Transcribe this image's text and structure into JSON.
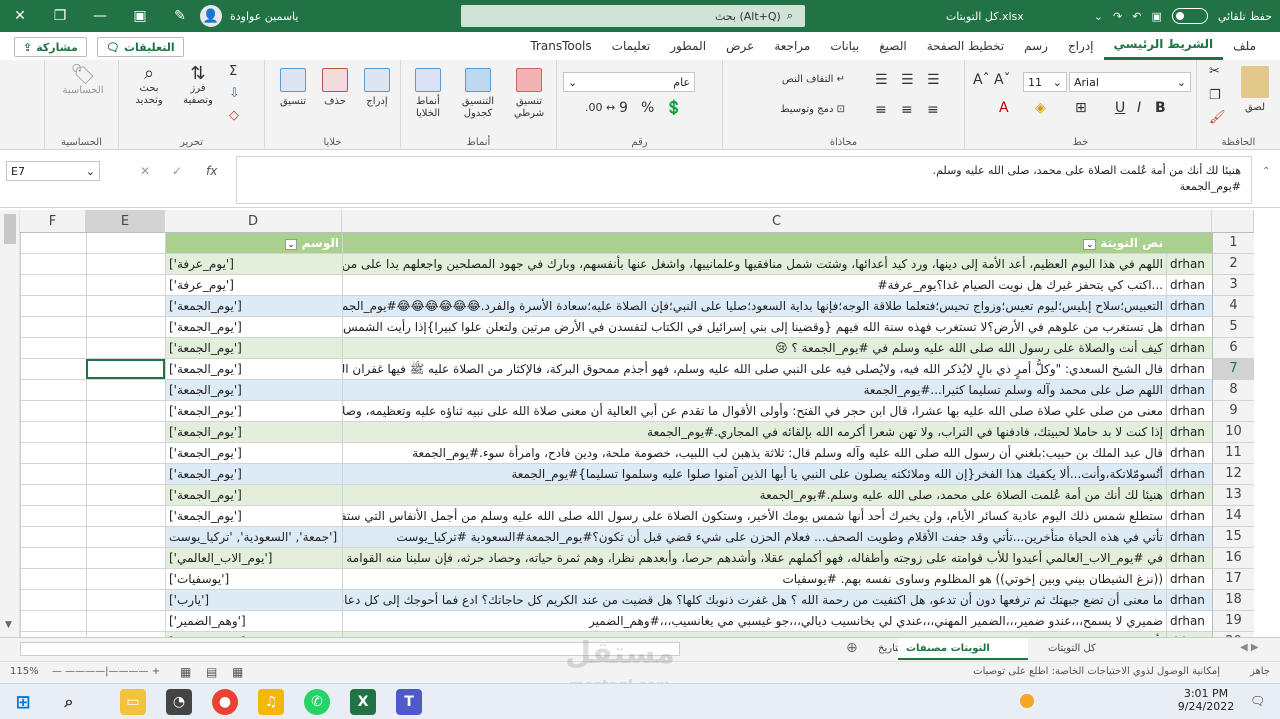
{
  "titlebar": {
    "autosave": "حفظ تلقائي",
    "filename": "كل التوبتات.xlsx",
    "search": "بحث (Alt+Q)",
    "user": "ياسمين عواودة"
  },
  "menu": {
    "tabs": [
      "ملف",
      "الشريط الرئيسي",
      "إدراج",
      "رسم",
      "تخطيط الصفحة",
      "الصيغ",
      "بيانات",
      "مراجعة",
      "عرض",
      "المطور",
      "تعليمات",
      "TransTools"
    ],
    "active": "الشريط الرئيسي",
    "share": "مشاركة",
    "comments": "التعليقات"
  },
  "ribbon": {
    "clipboard": {
      "label": "الحافظة",
      "paste": "لصق"
    },
    "font": {
      "label": "خط",
      "name": "Arial",
      "size": "11"
    },
    "alignment": {
      "label": "محاذاة",
      "wrap": "التفاف النص",
      "merge": "دمج وتوسيط"
    },
    "number": {
      "label": "رقم",
      "format": "عام"
    },
    "styles": {
      "label": "أنماط",
      "cond": "تنسيق شرطي",
      "table": "التنسيق كجدول",
      "cell": "أنماط الخلايا"
    },
    "cells": {
      "label": "خلايا",
      "insert": "إدراج",
      "delete": "حذف",
      "format": "تنسيق"
    },
    "editing": {
      "label": "تحرير",
      "sort": "فرز وتصفية",
      "find": "بحث وتحديد"
    },
    "analysis": {
      "label": "الحساسية",
      "button": "الحساسية"
    }
  },
  "formula": {
    "namebox": "E7",
    "line1": "هنيئا لك أنك من أمة عُلمت الصلاة على محمد، صلى الله عليه وسلم.",
    "line2": "#يوم_الجمعة"
  },
  "columns": [
    "F",
    "E",
    "D",
    "C"
  ],
  "header": {
    "b": "",
    "c": "نص التويتة",
    "d": "الوسم"
  },
  "rows": [
    {
      "n": "2",
      "b": "drhan",
      "c": "اللهم في هذا اليوم العظيم، أعد الأمة إلى دينها، ورد كيد أعدائها، وشتت شمل منافقيها وعلمانييها، واشغل عنها بأنفسهم، وبارك في جهود المصلحين واجعلهم يدا على من",
      "d": "['يوم_عرفة']",
      "s": "g"
    },
    {
      "n": "3",
      "b": "drhan",
      "c": "...اكتب كي يتحفز غيرك هل نويت الصيام غدا؟يوم_عرفة#",
      "d": "['يوم_عرفة']",
      "s": ""
    },
    {
      "n": "4",
      "b": "drhan",
      "c": "التعبيس؛سلاح إبليس؛ليوم تعيس؛وزواج تحيس؛فتعلما طلاقة الوجه؛فإنها بداية السعود؛صليا على النبي؛فإن الصلاة عليه؛سعادة الأسرة والفرد.😂😂😂😂😂😂#يوم_الجمعة",
      "d": "['يوم_الجمعة']",
      "s": "b"
    },
    {
      "n": "5",
      "b": "drhan",
      "c": "هل تستغرب من علوهم في الأرض؟لا تستغرب فهذه سنة الله فيهم {وقضينا إلى بني إسرائيل في الكتاب لتفسدن في الأرض مرتين ولتعلن علوا كبيرا}إذا رأيت الشمس في",
      "d": "['يوم_الجمعة']",
      "s": ""
    },
    {
      "n": "6",
      "b": "drhan",
      "c": "كيف أنت والصلاة على رسول الله صلى الله عليه وسلم في #يوم_الجمعة ؟ 😢",
      "d": "['يوم_الجمعة']",
      "s": "g"
    },
    {
      "n": "7",
      "b": "drhan",
      "c": "قال الشيخ السعدي: \"وكلُّ أمرٍ ذي بالٍ لايُذكر الله فيه، ولايُصلى فيه على النبي صلى الله عليه وسلم، فهو أجذم ممحوق البركة، فالإكثار من الصلاة عليه ﷺ فيها غفران الزلا",
      "d": "['يوم_الجمعة']",
      "s": ""
    },
    {
      "n": "8",
      "b": "drhan",
      "c": "اللهم صل على محمد وآله وسلم تسليما كثيرا...#يوم_الجمعة",
      "d": "['يوم_الجمعة']",
      "s": "b"
    },
    {
      "n": "9",
      "b": "drhan",
      "c": "معنى من صلى علي صلاة صلى الله عليه بها عشرا، قال ابن حجر في الفتح: وأولى الأقوال ما تقدم عن أبي العالية أن معنى صلاة الله على نبيه ثناؤه عليه وتعظيمه، وصلا",
      "d": "['يوم_الجمعة']",
      "s": ""
    },
    {
      "n": "10",
      "b": "drhan",
      "c": "إذا كنت لا بد حاملا لحبيتك، فادفنها في التراب، ولا تهن شعرا أكرمه الله بإلقائه في المجاري.#يوم_الجمعة",
      "d": "['يوم_الجمعة']",
      "s": "g"
    },
    {
      "n": "11",
      "b": "drhan",
      "c": "قال عبد الملك بن حبيب:بلغني أن رسول الله صلى الله عليه وآله وسلم قال: ثلاثة يذهبن لب اللبيب، خصومة ملحة، ودين فادح، وامرأة سوء.#يوم_الجمعة",
      "d": "['يوم_الجمعة']",
      "s": ""
    },
    {
      "n": "12",
      "b": "drhan",
      "c": "أتُسومّلاتكة،وأنت...ألا يكفيك هذا الفخر{إن الله وملائكته يصلون على النبي يا أيها الذين آمنوا صلوا عليه وسلموا تسليما}#يوم_الجمعة",
      "d": "['يوم_الجمعة']",
      "s": "b"
    },
    {
      "n": "13",
      "b": "drhan",
      "c": "هنيئا لك أنك من أمة عُلمت الصلاة على محمد، صلى الله عليه وسلم.#يوم_الجمعة",
      "d": "['يوم_الجمعة']",
      "s": "g"
    },
    {
      "n": "14",
      "b": "drhan",
      "c": "ستطلع شمس ذلك اليوم عادية كسائر الأيام، ولن يخبرك أحد أنها شمس يومك الأخير، وستكون الصلاة على رسول الله صلى الله عليه وسلم من أجمل الأنفاس التي ستفرح بها",
      "d": "['يوم_الجمعة']",
      "s": ""
    },
    {
      "n": "15",
      "b": "drhan",
      "c": "تأتي في هذه الحياة متأخرين...تأتي وقد جفت الأقلام وطويت الصحف... فعلام الحزن على شيء قضي قبل أن تكون؟#يوم_الجمعة#السعودية #تركيا_يوست",
      "d": "جمعة', 'السعودية', 'تركيا_يوست']",
      "s": "b"
    },
    {
      "n": "16",
      "b": "drhan",
      "c": "في #يوم_الاب_العالمي أعيدوا للأب قوامته على زوجته وأطفاله، فهو أكملهم عقلا، وأشدهم حرصا، وأبعدهم نظرا، وهم ثمرة حياته، وحصاد حرثه، فإن سلبنا منه القوامة",
      "d": "['يوم_الاب_العالمي']",
      "s": "g"
    },
    {
      "n": "17",
      "b": "drhan",
      "c": "((نزغ الشيطان بيني وبين إخوتي)) هو المظلوم وساوى نفسه بهم. #يوسفيات",
      "d": "['يوسفيات']",
      "s": ""
    },
    {
      "n": "18",
      "b": "drhan",
      "c": "ما معنى أن تضع جبهتك ثم ترفعها دون أن تدعو، هل اكتفيت من رحمة الله ؟ هل غفرت ذنوبك كلها؟ هل قضيت من عند الكريم كل حاجاتك؟ ادع فما أحوجك إلى كل دعاء",
      "d": "['يارب']",
      "s": "b"
    },
    {
      "n": "19",
      "b": "drhan",
      "c": "ضميري لا يسمح،،،عندو ضمير،،،الضمير المهني،،،عندي لي يخانسيب ديالي،،،جو غيسبي مي يغانسيب،،،#وهم_الضمير",
      "d": "['وهم_الضمير']",
      "s": ""
    },
    {
      "n": "20",
      "b": "drhan",
      "c": "بأكثر بكل الحميم... #وهم_الضمير كيف يرتاح هؤلاء، هذه القشرة الرقيقة للمنطقة العليا...",
      "d": "['وهم_الضمير']",
      "s": "g"
    }
  ],
  "sheets": {
    "active": "التويتات مصنفات حسب الهاشتقات",
    "other1": "كل التويتات حسب التاريخ",
    "other2": "كل التويتات"
  },
  "status": {
    "ready": "جاهز",
    "access": "إمكانية الوصول لذوي الاحتياجات الخاصة: اطلع على توصيات",
    "zoom": "115%"
  },
  "watermark": {
    "brand": "مستقل",
    "url": "mostaql.com"
  },
  "taskbar": {
    "time": "3:01 PM",
    "date": "9/24/2022"
  },
  "colors": {
    "excel_green": "#217346",
    "row_green": "#e2efda",
    "row_blue": "#ddebf7",
    "header_green": "#a9d08e"
  }
}
